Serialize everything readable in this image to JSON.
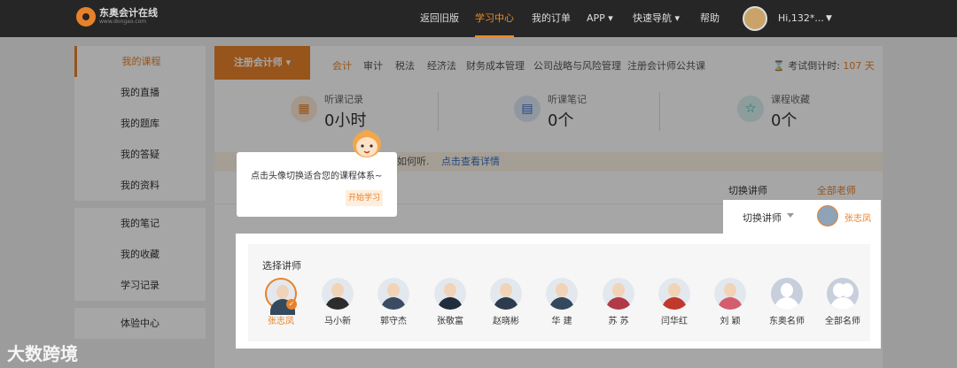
{
  "header": {
    "brand": "东奥会计在线",
    "brand_sub": "www.dongao.com",
    "nav": [
      "返回旧版",
      "学习中心",
      "我的订单",
      "APP ▾",
      "快速导航 ▾",
      "帮助"
    ],
    "user": "Hi,132*..."
  },
  "sidebar": {
    "group1": [
      "我的课程",
      "我的直播",
      "我的题库",
      "我的答疑",
      "我的资料"
    ],
    "group2": [
      "我的笔记",
      "我的收藏",
      "学习记录"
    ],
    "group3": [
      "体验中心"
    ]
  },
  "main": {
    "course_type": "注册会计师 ▾",
    "subjects": [
      "会计",
      "审计",
      "税法",
      "经济法",
      "财务成本管理",
      "公司战略与风险管理",
      "注册会计师公共课"
    ],
    "countdown_label": "考试倒计时:",
    "countdown_value": "107 天",
    "stats": [
      {
        "label": "听课记录",
        "value": "0小时"
      },
      {
        "label": "听课笔记",
        "value": "0个"
      },
      {
        "label": "课程收藏",
        "value": "0个"
      }
    ],
    "notice_partial": "如何听.",
    "notice_link": "点击查看详情",
    "switch_label": "切换讲师",
    "all_teachers": "全部老师"
  },
  "popup": {
    "text": "点击头像切换适合您的课程体系~",
    "button": "开始学习"
  },
  "tab_switch": {
    "label": "切换讲师",
    "current": "张志凤"
  },
  "teacher_panel": {
    "title": "选择讲师",
    "teachers": [
      "张志凤",
      "马小新",
      "郭守杰",
      "张敬富",
      "赵晓彬",
      "华 建",
      "苏 苏",
      "闫华红",
      "刘 颖",
      "东奥名师",
      "全部名师"
    ]
  },
  "colors": {
    "accent": "#e8822a",
    "topbar": "#262626",
    "link": "#3a6fc0"
  },
  "watermark": "大数跨境"
}
